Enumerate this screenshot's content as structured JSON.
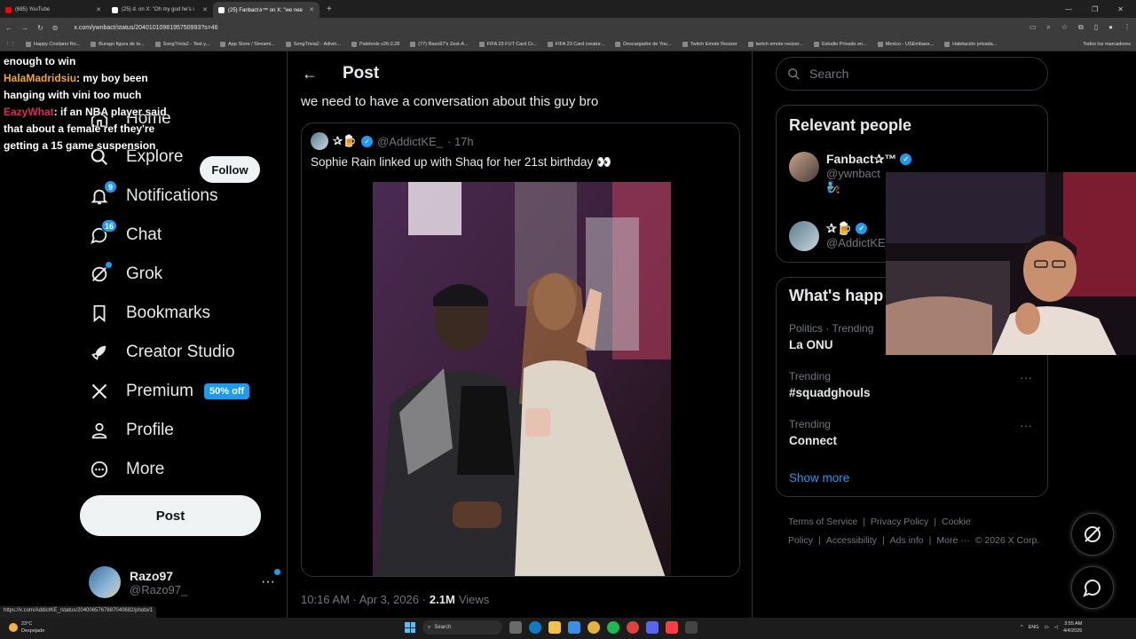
{
  "browser": {
    "tabs": [
      {
        "title": "(685) YouTube",
        "color": "#ff0000",
        "active": false
      },
      {
        "title": "(25) d. on X: \"Oh my god he's i",
        "color": "#ffffff",
        "active": false
      },
      {
        "title": "(25) Fanbact✰™ on X: \"we nee",
        "color": "#ffffff",
        "active": true
      }
    ],
    "new_tab": "+",
    "url": "x.com/ywnbact/status/2040101098195750993?s=46",
    "bookmarks": [
      "Happy Cristiano Ro...",
      "Burago figura de to...",
      "SongTrivia2 - Test y...",
      "App Store / Streami...",
      "SongTrivia2 - Adivin...",
      "Paletools v26.0.28",
      "(77) Razo97's Zest-A...",
      "FIFA 23 FUT Card Cr...",
      "FIFA 23 Card creator...",
      "Descargador de You...",
      "Twitch Emote Resizer",
      "twitch emote resizer...",
      "Estudio Privado en...",
      "Mexico - USEmbass...",
      "Habitación privada..."
    ],
    "bookmarks_folder": "Todos los marcadores",
    "status_url": "https://x.com/AddictKE_/status/2040065767887040682/photo/1"
  },
  "chat_overlay": {
    "line0": "enough to win",
    "msg1_user": "HalaMadridsiu",
    "msg1_text": ": my boy been hanging with vini too much",
    "msg2_user": "EazyWhat",
    "msg2_text": ": if an NBA player said that about a female ref they're getting a 15 game suspension"
  },
  "nav": {
    "items": [
      {
        "label": "Home",
        "icon": "home-icon"
      },
      {
        "label": "Explore",
        "icon": "search-icon"
      },
      {
        "label": "Notifications",
        "icon": "bell-icon",
        "badge": "9"
      },
      {
        "label": "Chat",
        "icon": "chat-icon",
        "badge": "16"
      },
      {
        "label": "Grok",
        "icon": "grok-icon"
      },
      {
        "label": "Bookmarks",
        "icon": "bookmark-icon"
      },
      {
        "label": "Creator Studio",
        "icon": "rocket-icon"
      },
      {
        "label": "Premium",
        "icon": "x-logo-icon",
        "pill": "50% off"
      },
      {
        "label": "Profile",
        "icon": "person-icon"
      },
      {
        "label": "More",
        "icon": "more-circle-icon"
      }
    ],
    "post_button": "Post",
    "account": {
      "name": "Razo97",
      "handle": "@Razo97_",
      "more": "···"
    }
  },
  "post": {
    "header_title": "Post",
    "text": "we need to have a conversation about this guy bro",
    "quote": {
      "name": "✰🍺",
      "handle": "@AddictKE_",
      "time": "· 17h",
      "text": "Sophie Rain linked up with Shaq for her 21st birthday 👀"
    },
    "meta_time": "10:16 AM · Apr 3, 2026 ·",
    "meta_views_count": "2.1M",
    "meta_views_label": "Views"
  },
  "right": {
    "search_placeholder": "Search",
    "relevant_title": "Relevant people",
    "people": [
      {
        "name": "Fanbact✰™",
        "handle": "@ywnbact",
        "bio": "🧞"
      },
      {
        "name": "✰🍺",
        "handle": "@AddictKE_",
        "bio": ""
      }
    ],
    "follow_label": "Follow",
    "happening_title": "What's happ",
    "trends": [
      {
        "category": "Politics · Trending",
        "name": "La ONU"
      },
      {
        "category": "Trending",
        "name": "#squadghouls"
      },
      {
        "category": "Trending",
        "name": "Connect"
      }
    ],
    "trend_more": "···",
    "show_more": "Show more",
    "footer": [
      "Terms of Service",
      "|",
      "Privacy Policy",
      "|",
      "Cookie Policy",
      "|",
      "Accessibility",
      "|",
      "Ads info",
      "|",
      "More ···",
      "© 2026 X Corp."
    ]
  },
  "taskbar": {
    "temp": "23°C",
    "weather": "Despejado",
    "search": "Search",
    "lang": "ENG",
    "time": "3:55 AM",
    "date": "4/4/2026"
  },
  "colors": {
    "accent": "#1d9bf0",
    "bg": "#000000",
    "border": "#2f3336",
    "muted": "#71767b"
  }
}
